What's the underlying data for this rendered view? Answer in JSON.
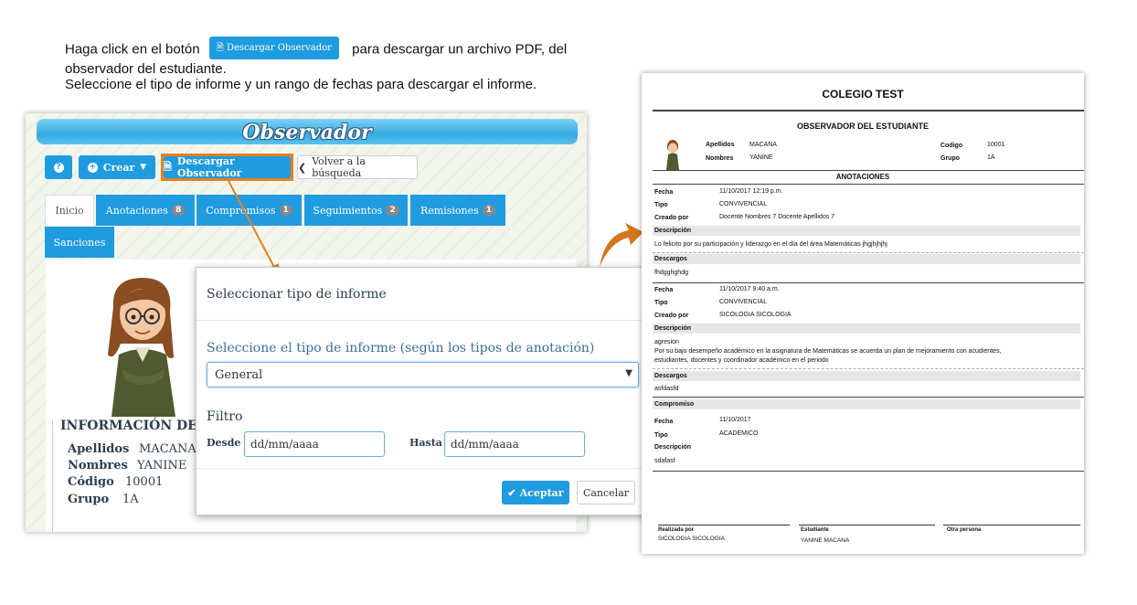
{
  "instructions": {
    "line1_before": "Haga click en el botón",
    "inline_button": "Descargar Observador",
    "line1_after": "para descargar un archivo PDF, del",
    "line2": "observador del estudiante.",
    "line3": "Seleccione el tipo de informe y un rango de fechas para descargar el informe."
  },
  "app": {
    "title": "Observador",
    "toolbar": {
      "help_icon": "?",
      "crear": "Crear",
      "descargar": "Descargar Observador",
      "volver": "Volver a la búsqueda"
    },
    "tabs": [
      {
        "label": "Inicio",
        "badge": ""
      },
      {
        "label": "Anotaciones",
        "badge": "8"
      },
      {
        "label": "Compromisos",
        "badge": "1"
      },
      {
        "label": "Seguimientos",
        "badge": "2"
      },
      {
        "label": "Remisiones",
        "badge": "1"
      },
      {
        "label": "Sanciones",
        "badge": ""
      }
    ],
    "info": {
      "title": "INFORMACIÓN DEL ES",
      "apellidos_label": "Apellidos",
      "apellidos": "MACANA",
      "nombres_label": "Nombres",
      "nombres": "YANINE",
      "codigo_label": "Código",
      "codigo": "10001",
      "grupo_label": "Grupo",
      "grupo": "1A"
    }
  },
  "modal": {
    "title": "Seleccionar tipo de informe",
    "select_label": "Seleccione el tipo de informe (según los tipos de anotación)",
    "select_value": "General",
    "filtro": "Filtro",
    "desde_label": "Desde",
    "desde_placeholder": "dd/mm/aaaa",
    "hasta_label": "Hasta",
    "hasta_placeholder": "dd/mm/aaaa",
    "aceptar": "Aceptar",
    "cancelar": "Cancelar"
  },
  "pdf": {
    "school": "COLEGIO TEST",
    "subtitle": "OBSERVADOR DEL ESTUDIANTE",
    "apellidos_label": "Apellidos",
    "apellidos": "MACANA",
    "nombres_label": "Nombres",
    "nombres": "YANINE",
    "codigo_label": "Codigo",
    "codigo": "10001",
    "grupo_label": "Grupo",
    "grupo": "1A",
    "anotaciones": "ANOTACIONES",
    "fecha_label": "Fecha",
    "tipo_label": "Tipo",
    "creado_label": "Creado por",
    "descripcion_label": "Descripción",
    "descargos_label": "Descargos",
    "entry1": {
      "fecha": "11/10/2017  12:19 p.m.",
      "tipo": "CONVIVENCIAL",
      "creado": "Docente Nombres 7 Docente Apellidos 7",
      "descripcion": "Lo felicito por su participación y liderazgo en el día del área Matemáticas jhgjhjhjhj",
      "descargos": "fhdgghghdg"
    },
    "entry2": {
      "fecha": "11/10/2017  9:40 a.m.",
      "tipo": "CONVIVENCIAL",
      "creado": "SICOLOGIA SICOLOGIA",
      "descripcion1": "agresion",
      "descripcion2": "Por su bajo desempeño académico en la asignatura de Matemáticas se acuerda un plan de mejoramiento con acudientes,",
      "descripcion3": "estudiantes, docentes y coordinador académico en el periodo",
      "descargos": "asfdasfd"
    },
    "compromiso_label": "Compromiso",
    "entry3": {
      "fecha": "11/10/2017",
      "tipo": "ACADÉMICO",
      "descripcion": "sdafasf"
    },
    "footer": {
      "realizada_label": "Realizada por",
      "realizada": "SICOLOGIA SICOLOGIA",
      "estudiante_label": "Estudiante",
      "estudiante": "YANINE MACANA",
      "otra_label": "Otra persona"
    }
  },
  "colors": {
    "primary": "#1f9be0",
    "highlight": "#e8801f"
  }
}
